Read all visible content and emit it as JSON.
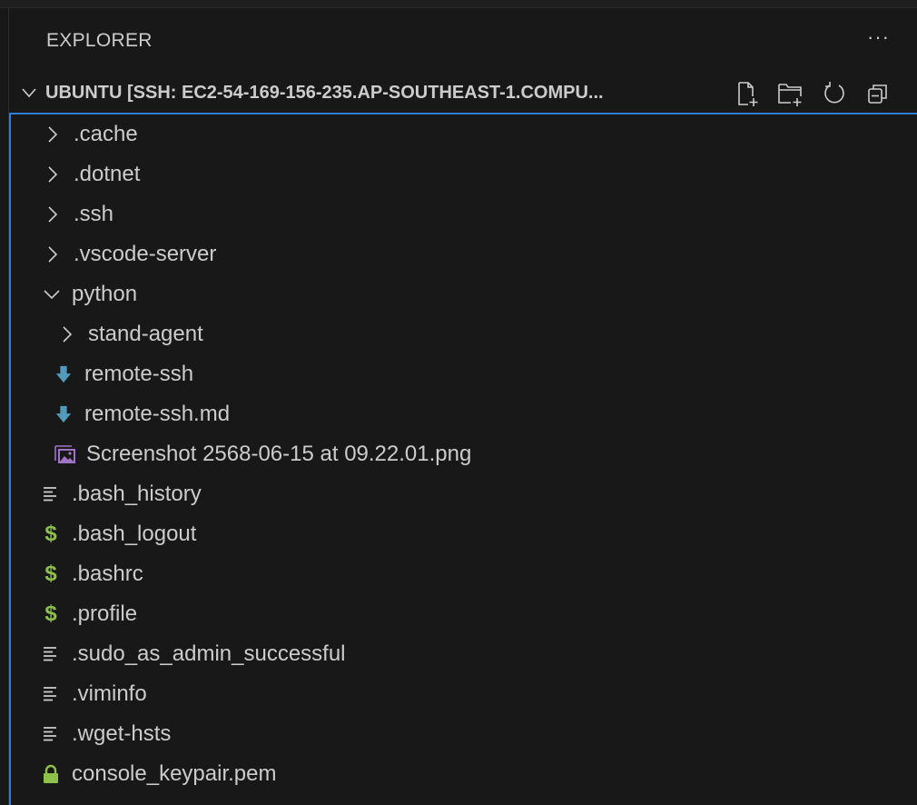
{
  "explorer": {
    "title": "EXPLORER",
    "more_label": "···",
    "section_title": "UBUNTU [SSH: EC2-54-169-156-235.AP-SOUTHEAST-1.COMPU...",
    "actions": [
      "new-file-icon",
      "new-folder-icon",
      "refresh-icon",
      "collapse-all-icon"
    ]
  },
  "colors": {
    "accent": "#2f7ed4",
    "markdown": "#519aba",
    "image": "#a074c4",
    "shell": "#8dc149",
    "lock": "#8dc149"
  },
  "tree": [
    {
      "label": ".cache",
      "type": "folder",
      "depth": 0,
      "expanded": false
    },
    {
      "label": ".dotnet",
      "type": "folder",
      "depth": 0,
      "expanded": false
    },
    {
      "label": ".ssh",
      "type": "folder",
      "depth": 0,
      "expanded": false
    },
    {
      "label": ".vscode-server",
      "type": "folder",
      "depth": 0,
      "expanded": false
    },
    {
      "label": "python",
      "type": "folder",
      "depth": 0,
      "expanded": true
    },
    {
      "label": "stand-agent",
      "type": "folder",
      "depth": 1,
      "expanded": false
    },
    {
      "label": "remote-ssh",
      "type": "markdown",
      "depth": 1
    },
    {
      "label": "remote-ssh.md",
      "type": "markdown",
      "depth": 1
    },
    {
      "label": "Screenshot 2568-06-15 at 09.22.01.png",
      "type": "image",
      "depth": 1
    },
    {
      "label": ".bash_history",
      "type": "text",
      "depth": 0
    },
    {
      "label": ".bash_logout",
      "type": "shell",
      "depth": 0
    },
    {
      "label": ".bashrc",
      "type": "shell",
      "depth": 0
    },
    {
      "label": ".profile",
      "type": "shell",
      "depth": 0
    },
    {
      "label": ".sudo_as_admin_successful",
      "type": "text",
      "depth": 0
    },
    {
      "label": ".viminfo",
      "type": "text",
      "depth": 0
    },
    {
      "label": ".wget-hsts",
      "type": "text",
      "depth": 0
    },
    {
      "label": "console_keypair.pem",
      "type": "key",
      "depth": 0
    }
  ]
}
